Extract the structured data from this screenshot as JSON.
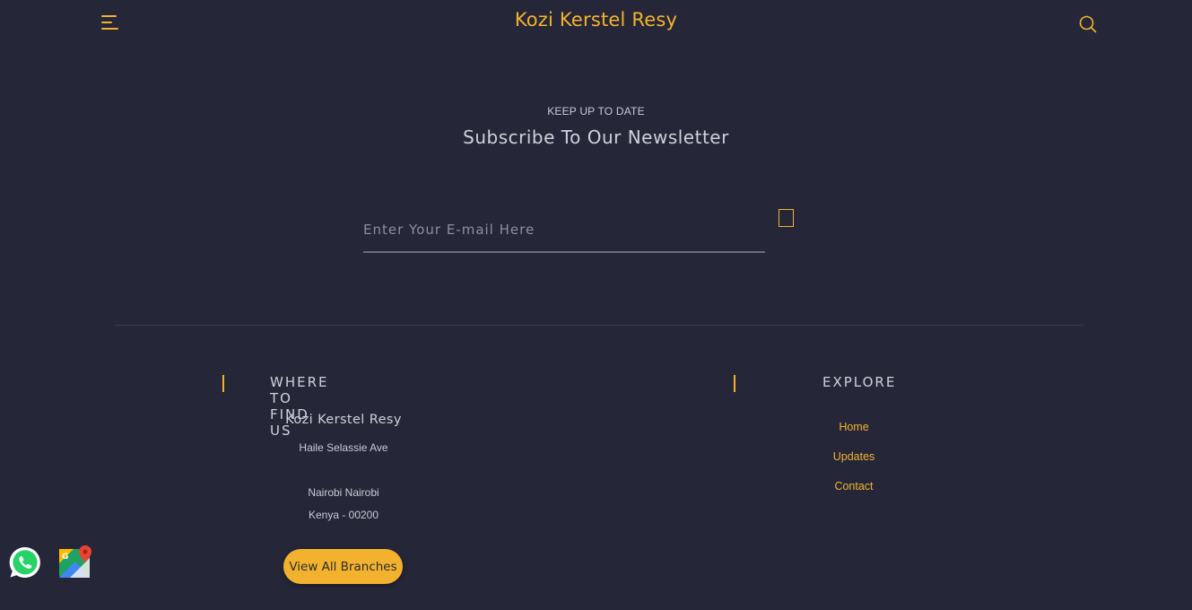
{
  "header": {
    "site_title": "Kozi Kerstel Resy",
    "menu_icon": "hamburger-menu-icon",
    "search_icon": "search-icon"
  },
  "newsletter": {
    "eyebrow": "KEEP UP TO DATE",
    "title": "Subscribe To Our Newsletter",
    "email_placeholder": "Enter Your E-mail Here",
    "email_value": "",
    "submit_icon": "send-icon"
  },
  "find_us": {
    "heading": "WHERE TO FIND US",
    "business_name": "Kozi Kerstel Resy",
    "street": "Haile Selassie Ave",
    "city": "Nairobi Nairobi",
    "country_postal": "Kenya - 00200",
    "branches_button": "View All Branches"
  },
  "explore": {
    "heading": "EXPLORE",
    "links": [
      "Home",
      "Updates",
      "Contact"
    ]
  },
  "floating": {
    "whatsapp_icon": "whatsapp-icon",
    "maps_icon": "google-maps-icon"
  },
  "colors": {
    "background": "#252739",
    "accent": "#f3b22e",
    "text": "#c9cad3"
  }
}
